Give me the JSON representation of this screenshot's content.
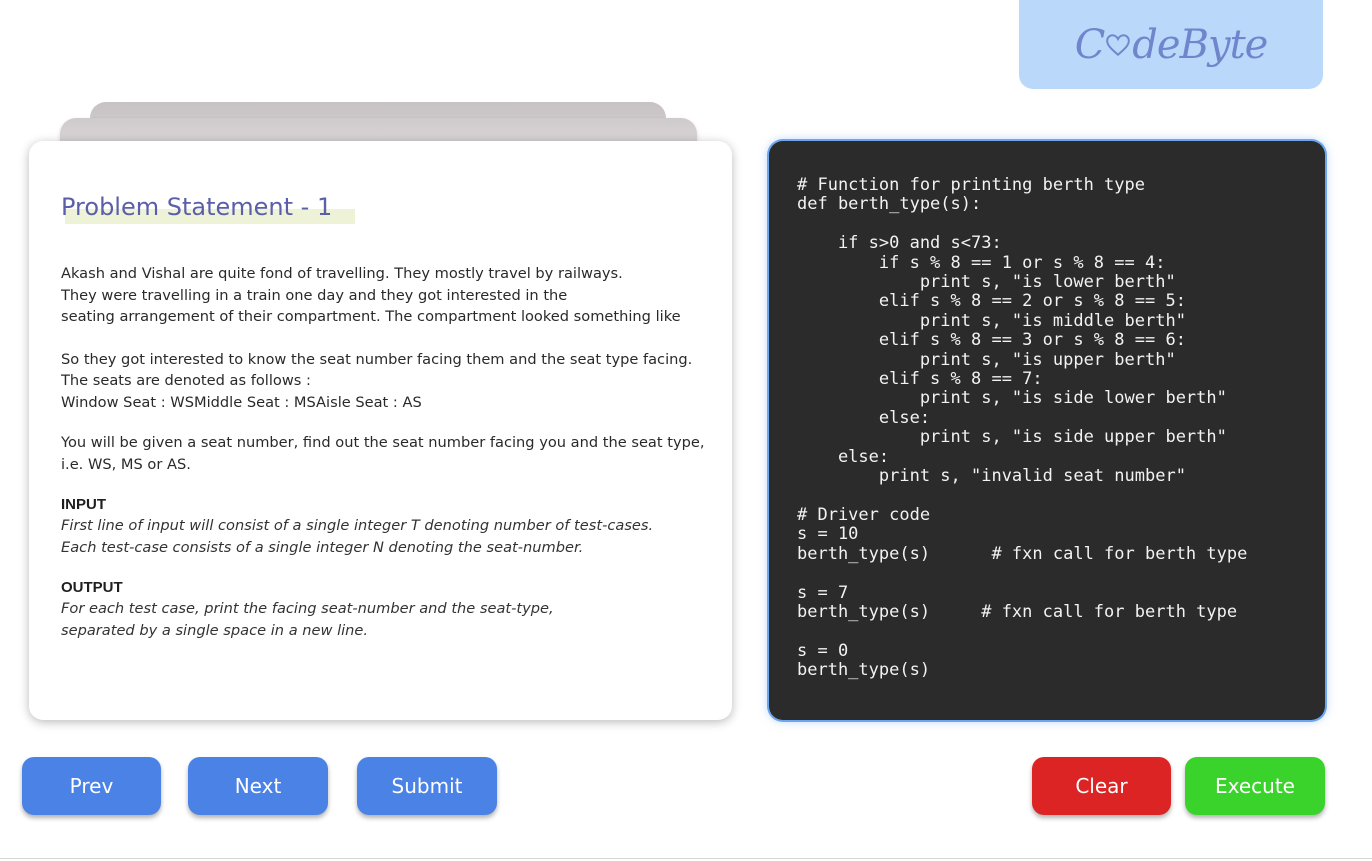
{
  "logo": {
    "text_before": "C",
    "text_after": "deByte"
  },
  "problem": {
    "title": "Problem Statement - 1",
    "paragraph1": [
      "Akash and Vishal are quite fond of travelling. They mostly travel by railways.",
      "They were travelling in a train one day and they got interested in the",
      "seating arrangement of their compartment. The compartment looked something like"
    ],
    "paragraph2": [
      "So they got interested to know the seat number facing them and the seat type facing.",
      "The seats are denoted as follows :",
      "Window Seat : WSMiddle Seat : MSAisle Seat : AS"
    ],
    "paragraph3": [
      "You will be given a seat number, find out the seat number facing you and the seat type,",
      "i.e. WS, MS or AS."
    ],
    "input_heading": "INPUT",
    "input_lines": [
      "First line of input will consist of a single integer T denoting number of test-cases.",
      "Each test-case consists of a single integer N denoting the seat-number."
    ],
    "output_heading": "OUTPUT",
    "output_lines": [
      "For each test case, print the facing seat-number and the seat-type,",
      "separated by a single space in a new line."
    ]
  },
  "code": "# Function for printing berth type\ndef berth_type(s):\n\n    if s>0 and s<73:\n        if s % 8 == 1 or s % 8 == 4:\n            print s, \"is lower berth\"\n        elif s % 8 == 2 or s % 8 == 5:\n            print s, \"is middle berth\"\n        elif s % 8 == 3 or s % 8 == 6:\n            print s, \"is upper berth\"\n        elif s % 8 == 7:\n            print s, \"is side lower berth\"\n        else:\n            print s, \"is side upper berth\"\n    else:\n        print s, \"invalid seat number\"\n\n# Driver code\ns = 10\nberth_type(s)      # fxn call for berth type\n\ns = 7\nberth_type(s)     # fxn call for berth type\n\ns = 0\nberth_type(s)",
  "buttons": {
    "prev": "Prev",
    "next": "Next",
    "submit": "Submit",
    "clear": "Clear",
    "execute": "Execute"
  },
  "colors": {
    "primary_button": "#4b82e6",
    "clear_button": "#dd2424",
    "execute_button": "#3ad32c",
    "code_background": "#2b2b2b",
    "logo_background": "#b9d8fa",
    "title_color": "#5b5ea8"
  }
}
